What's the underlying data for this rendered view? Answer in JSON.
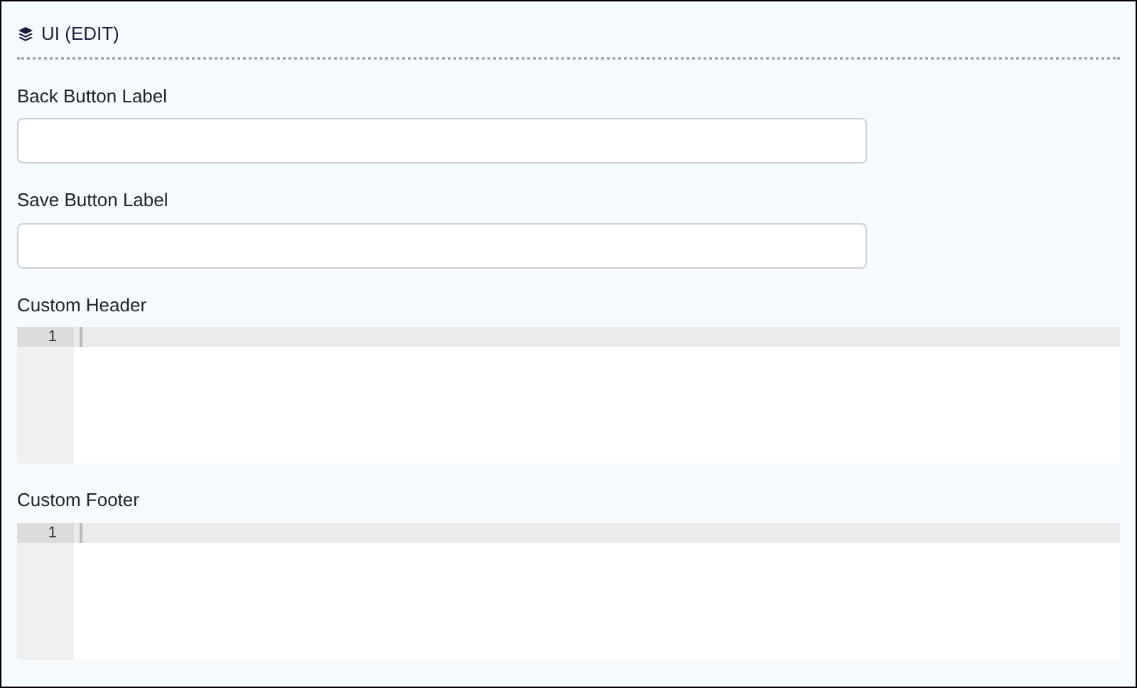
{
  "section": {
    "title": "UI (EDIT)"
  },
  "fields": [
    {
      "label": "Back Button Label",
      "kind": "text"
    },
    {
      "label": "Save Button Label",
      "kind": "text"
    },
    {
      "label": "Custom Header",
      "kind": "code",
      "line_numbers": [
        "1"
      ]
    },
    {
      "label": "Custom Footer",
      "kind": "code",
      "line_numbers": [
        "1"
      ]
    }
  ]
}
